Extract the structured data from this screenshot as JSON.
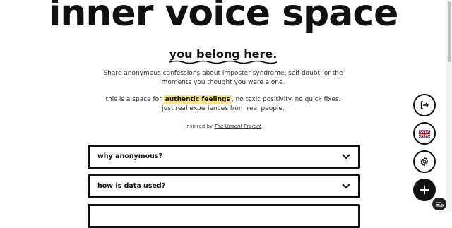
{
  "hero": {
    "title": "inner voice space",
    "tagline": "you belong here.",
    "intro": "Share anonymous confessions about imposter syndrome, self-doubt, or the moments you thought you were alone.",
    "intro2_before": "this is a space for ",
    "intro2_highlight": "authentic feelings",
    "intro2_after": ". no toxic positivity. no quick fixes. just real experiences from real people.",
    "credit_prefix": "inspired by ",
    "credit_link": "The Unsent Project"
  },
  "faq": [
    {
      "label": "why anonymous?"
    },
    {
      "label": "how is data used?"
    }
  ],
  "actions": {
    "logout_icon": "logout-icon",
    "language_icon": "uk-flag-icon",
    "settings_icon": "gear-icon",
    "add_icon": "plus-icon",
    "misc_icon": "tag-icon"
  },
  "colors": {
    "highlight": "#f7e57f",
    "ink": "#111111",
    "background": "#ffffff"
  }
}
